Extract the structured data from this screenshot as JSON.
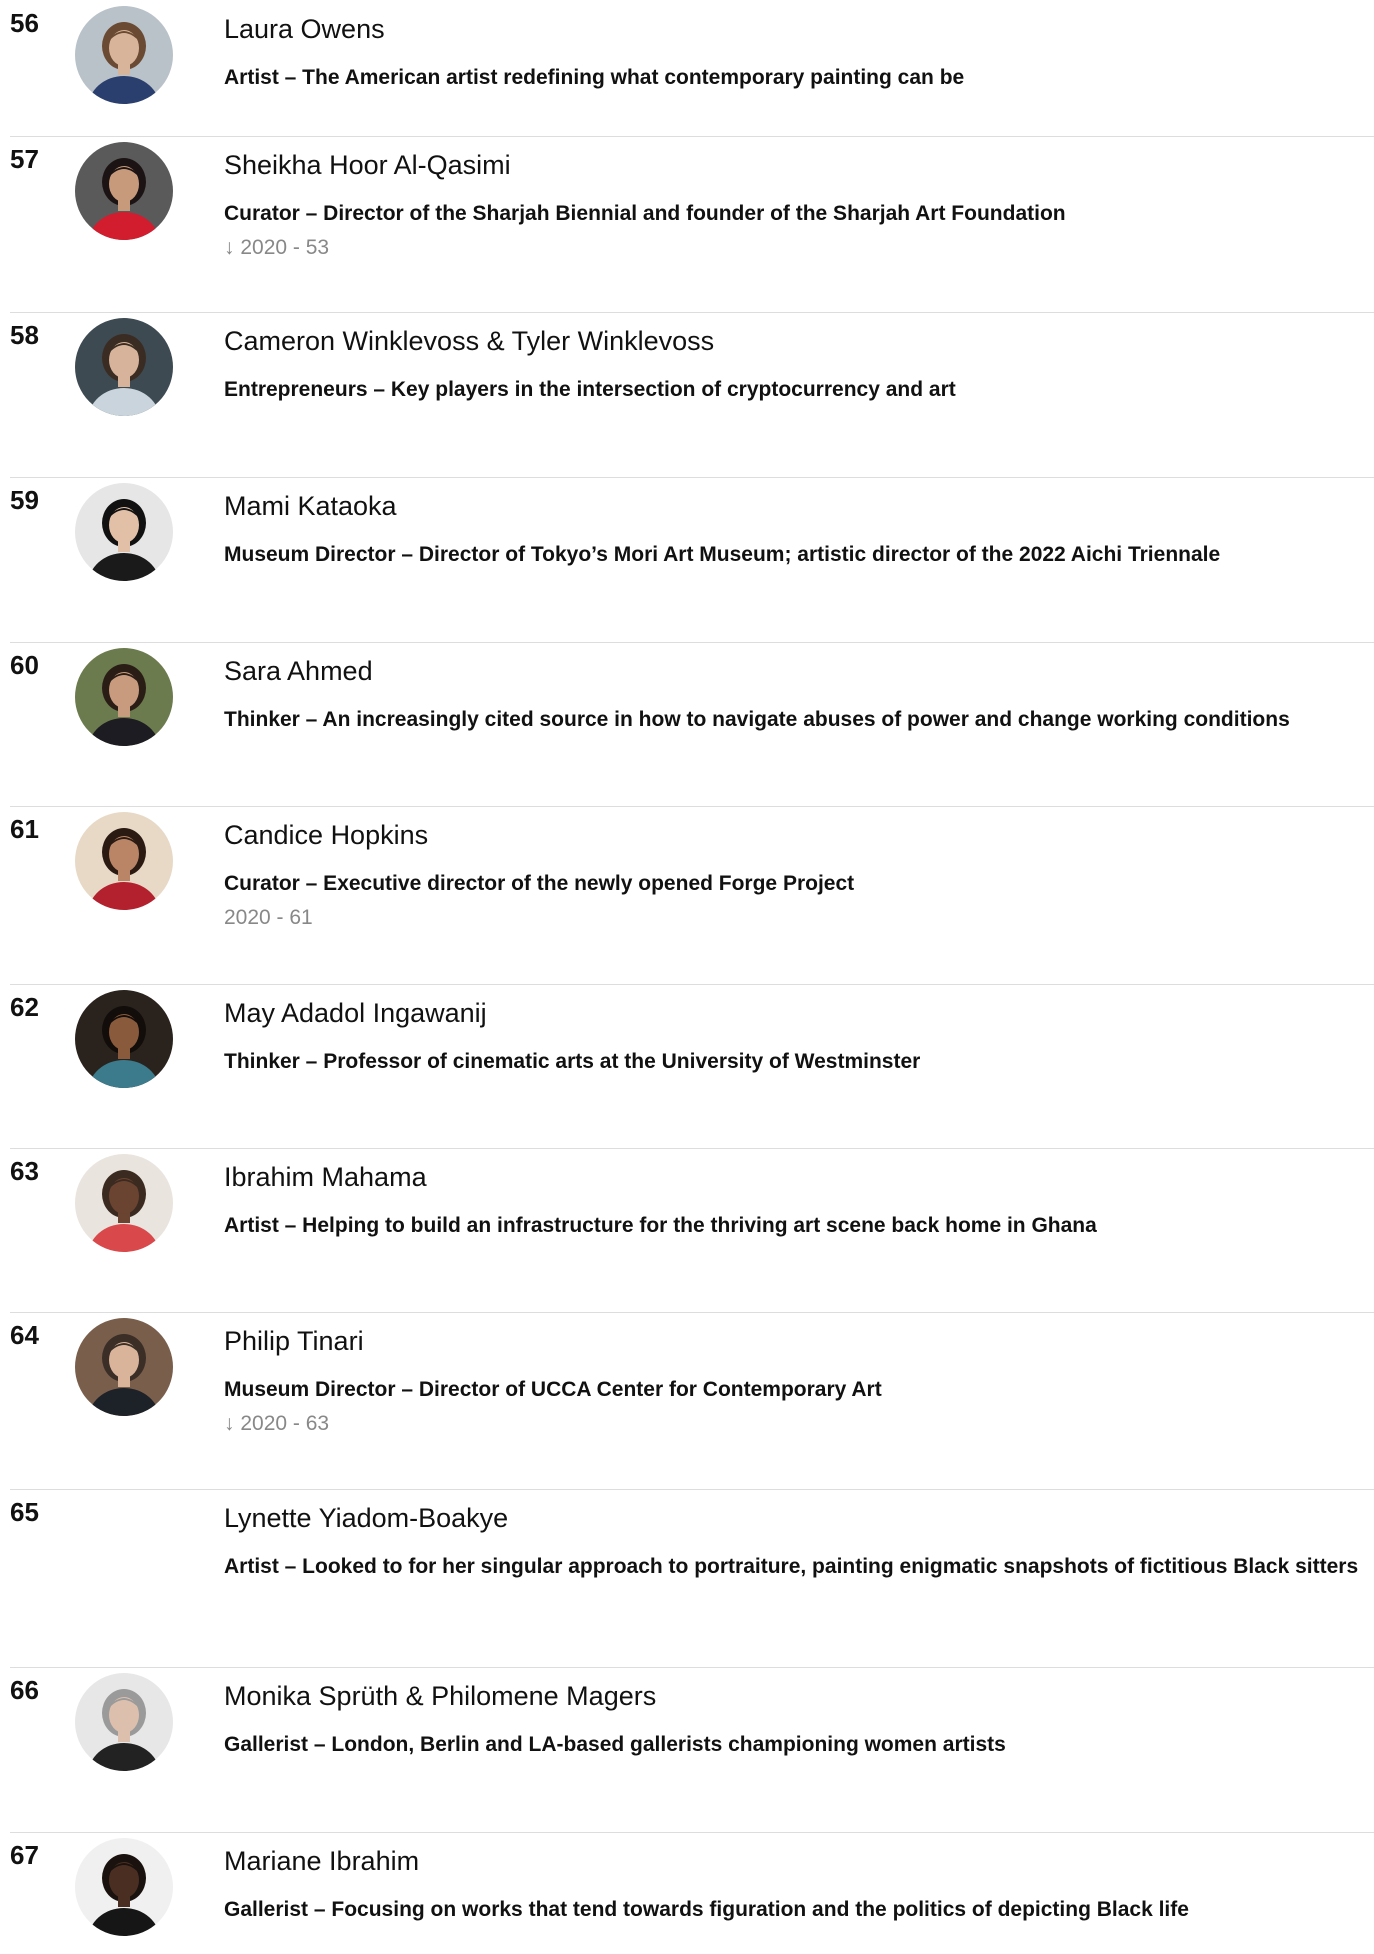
{
  "entries": [
    {
      "rank": "56",
      "name": "Laura Owens",
      "description": "Artist – The American artist redefining what contemporary painting can be",
      "previous": "",
      "has_photo": true,
      "photo": {
        "bg": "#b9c2c9",
        "skin": "#d8b49a",
        "hair": "#6a4a33",
        "clothes": "#2b3f6e"
      }
    },
    {
      "rank": "57",
      "name": "Sheikha Hoor Al-Qasimi",
      "description": "Curator – Director of the Sharjah Biennial and founder of the Sharjah Art Foundation",
      "previous": "↓ 2020 - 53",
      "has_photo": true,
      "photo": {
        "bg": "#5a5a5a",
        "skin": "#c79a7c",
        "hair": "#1c1414",
        "clothes": "#d21d2f"
      }
    },
    {
      "rank": "58",
      "name": "Cameron Winklevoss & Tyler Winklevoss",
      "description": "Entrepreneurs – Key players in the intersection of cryptocurrency and art",
      "previous": "",
      "has_photo": true,
      "photo": {
        "bg": "#3d4a52",
        "skin": "#d7b39b",
        "hair": "#3a2c22",
        "clothes": "#c9d4dc"
      }
    },
    {
      "rank": "59",
      "name": "Mami Kataoka",
      "description": "Museum Director – Director of Tokyo’s Mori Art Museum; artistic director of the 2022 Aichi Triennale",
      "previous": "",
      "has_photo": true,
      "photo": {
        "bg": "#e6e6e6",
        "skin": "#e1c0a7",
        "hair": "#111111",
        "clothes": "#1a1a1a"
      }
    },
    {
      "rank": "60",
      "name": "Sara Ahmed",
      "description": "Thinker – An increasingly cited source in how to navigate abuses of power and change working conditions",
      "previous": "",
      "has_photo": true,
      "photo": {
        "bg": "#6b7b4e",
        "skin": "#c89b7e",
        "hair": "#2a1d16",
        "clothes": "#1c1c22"
      }
    },
    {
      "rank": "61",
      "name": "Candice Hopkins",
      "description": "Curator – Executive director of the newly opened Forge Project",
      "previous": "2020 - 61",
      "has_photo": true,
      "photo": {
        "bg": "#e8d9c7",
        "skin": "#b98566",
        "hair": "#2a1a12",
        "clothes": "#b3202e"
      }
    },
    {
      "rank": "62",
      "name": "May Adadol Ingawanij",
      "description": "Thinker – Professor of cinematic arts at the University of Westminster",
      "previous": "",
      "has_photo": true,
      "photo": {
        "bg": "#2a231d",
        "skin": "#8a5a3c",
        "hair": "#120d0a",
        "clothes": "#3b7b8c"
      }
    },
    {
      "rank": "63",
      "name": "Ibrahim Mahama",
      "description": "Artist – Helping to build an infrastructure for the thriving art scene back home in Ghana",
      "previous": "",
      "has_photo": true,
      "photo": {
        "bg": "#e9e4de",
        "skin": "#6b4331",
        "hair": "#3b2a20",
        "clothes": "#d9484b"
      }
    },
    {
      "rank": "64",
      "name": "Philip Tinari",
      "description": "Museum Director – Director of UCCA Center for Contemporary Art",
      "previous": "↓ 2020 - 63",
      "has_photo": true,
      "photo": {
        "bg": "#7a5e4c",
        "skin": "#d9b49b",
        "hair": "#3a2e26",
        "clothes": "#1d2128"
      }
    },
    {
      "rank": "65",
      "name": "Lynette Yiadom-Boakye",
      "description": "Artist – Looked to for her singular approach to portraiture, painting enigmatic snapshots of fictitious Black sitters",
      "previous": "",
      "has_photo": false,
      "photo": {
        "bg": "#ffffff",
        "skin": "#ffffff",
        "hair": "#ffffff",
        "clothes": "#ffffff"
      }
    },
    {
      "rank": "66",
      "name": "Monika Sprüth & Philomene Magers",
      "description": "Gallerist – London, Berlin and LA-based gallerists championing women artists",
      "previous": "",
      "has_photo": true,
      "photo": {
        "bg": "#e7e7e7",
        "skin": "#dcc0ad",
        "hair": "#9a9a9a",
        "clothes": "#222222"
      }
    },
    {
      "rank": "67",
      "name": "Mariane Ibrahim",
      "description": "Gallerist – Focusing on works that tend towards figuration and the politics of depicting Black life",
      "previous": "",
      "has_photo": true,
      "photo": {
        "bg": "#f0f0f0",
        "skin": "#4a2e22",
        "hair": "#1a120e",
        "clothes": "#161616"
      }
    }
  ]
}
